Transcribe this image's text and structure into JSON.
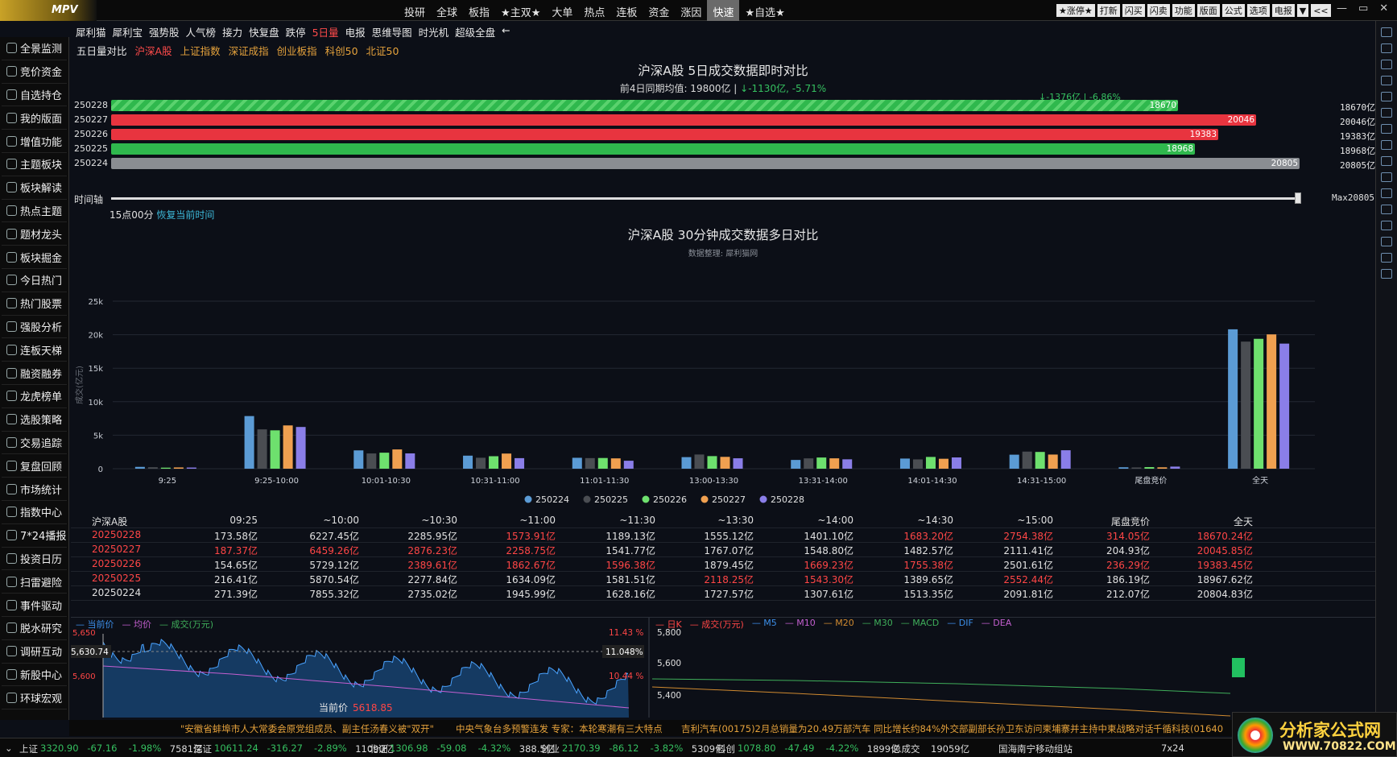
{
  "app": {
    "logo": "MPV"
  },
  "topmenu": [
    "投研",
    "全球",
    "板指",
    "★主双★",
    "大单",
    "热点",
    "连板",
    "资金",
    "涨因",
    "快速",
    "★自选★"
  ],
  "topmenu_active": "快速",
  "topright": [
    "★涨停★",
    "打新",
    "闪买",
    "闪卖",
    "功能",
    "版面",
    "公式",
    "选项",
    "电报",
    "▼",
    "<<"
  ],
  "winctl": [
    "—",
    "▭",
    "✕"
  ],
  "sidebar": [
    {
      "label": "全景监测",
      "icon": "globe-icon"
    },
    {
      "label": "竞价资金",
      "icon": "coin-icon"
    },
    {
      "label": "自选持仓",
      "icon": "home-icon"
    },
    {
      "label": "我的版面",
      "icon": "layout-icon"
    },
    {
      "label": "增值功能",
      "icon": "plus-icon"
    },
    {
      "label": "主题板块",
      "icon": "bar-icon"
    },
    {
      "label": "板块解读",
      "icon": "refresh-icon"
    },
    {
      "label": "热点主题",
      "icon": "gear-icon"
    },
    {
      "label": "题材龙头",
      "icon": "grid-icon"
    },
    {
      "label": "板块掘金",
      "icon": "shovel-icon"
    },
    {
      "label": "今日热门",
      "icon": "fire-icon"
    },
    {
      "label": "热门股票",
      "icon": "stock-icon"
    },
    {
      "label": "强股分析",
      "icon": "chart-icon"
    },
    {
      "label": "连板天梯",
      "icon": "ladder-icon"
    },
    {
      "label": "融资融券",
      "icon": "heart-icon"
    },
    {
      "label": "龙虎榜单",
      "icon": "dragon-icon"
    },
    {
      "label": "选股策略",
      "icon": "filter-icon"
    },
    {
      "label": "交易追踪",
      "icon": "track-icon"
    },
    {
      "label": "复盘回顾",
      "icon": "replay-icon"
    },
    {
      "label": "市场统计",
      "icon": "stats-icon"
    },
    {
      "label": "指数中心",
      "icon": "index-icon"
    },
    {
      "label": "7*24播报",
      "icon": "broadcast-icon"
    },
    {
      "label": "投资日历",
      "icon": "calendar-icon"
    },
    {
      "label": "扫雷避险",
      "icon": "shield-icon"
    },
    {
      "label": "事件驱动",
      "icon": "event-icon"
    },
    {
      "label": "脱水研究",
      "icon": "research-icon"
    },
    {
      "label": "调研互动",
      "icon": "chat-icon"
    },
    {
      "label": "新股中心",
      "icon": "new-icon"
    },
    {
      "label": "环球宏观",
      "icon": "world-icon"
    }
  ],
  "tabs1": [
    "犀利猫",
    "犀利宝",
    "强势股",
    "人气榜",
    "接力",
    "快复盘",
    "跌停",
    "5日量",
    "电报",
    "思维导图",
    "时光机",
    "超级全盘",
    "←"
  ],
  "tabs1_active": "5日量",
  "tabs2": [
    "五日量对比",
    "沪深A股",
    "上证指数",
    "深证成指",
    "创业板指",
    "科创50",
    "北证50"
  ],
  "tabs2_active": "沪深A股",
  "section1": {
    "title": "沪深A股 5日成交数据即时对比",
    "subtitle_prefix": "前4日同期均值: 19800亿 | ",
    "subtitle_change": "↓-1130亿, -5.71%",
    "top_note": "↓-1376亿 | -6.86%",
    "max": 20805,
    "bars": [
      {
        "date": "250228",
        "value": 18670,
        "right": "18670亿",
        "color": "#2fb84d",
        "striped": true
      },
      {
        "date": "250227",
        "value": 20046,
        "right": "20046亿",
        "color": "#e8343f",
        "striped": false
      },
      {
        "date": "250226",
        "value": 19383,
        "right": "19383亿",
        "color": "#e8343f",
        "striped": false
      },
      {
        "date": "250225",
        "value": 18968,
        "right": "18968亿",
        "color": "#2fb84d",
        "striped": false
      },
      {
        "date": "250224",
        "value": 20805,
        "right": "20805亿",
        "color": "#8a8d92",
        "striped": false
      }
    ],
    "timeaxis_label": "时间轴",
    "timeaxis_max": "Max20805",
    "time_now": "15点00分",
    "time_restore": "恢复当前时间"
  },
  "section2": {
    "title": "沪深A股 30分钟成交数据多日对比",
    "source": "数据整理: 犀利猫网"
  },
  "chart_data": {
    "type": "bar",
    "ylabel": "成交(亿元)",
    "ylim": [
      0,
      25000
    ],
    "yticks": [
      "0",
      "5k",
      "10k",
      "15k",
      "20k",
      "25k"
    ],
    "categories": [
      "9:25",
      "9:25-10:00",
      "10:01-10:30",
      "10:31-11:00",
      "11:01-11:30",
      "13:00-13:30",
      "13:31-14:00",
      "14:01-14:30",
      "14:31-15:00",
      "尾盘竞价",
      "全天"
    ],
    "series": [
      {
        "name": "250224",
        "color": "#5b9bd5",
        "values": [
          271.39,
          7855.32,
          2735.02,
          1945.99,
          1628.16,
          1727.57,
          1307.61,
          1513.35,
          2091.81,
          212.07,
          20804.83
        ]
      },
      {
        "name": "250225",
        "color": "#4a4d52",
        "values": [
          216.41,
          5870.54,
          2277.84,
          1634.09,
          1581.51,
          2118.25,
          1543.3,
          1389.65,
          2552.44,
          186.19,
          18967.62
        ]
      },
      {
        "name": "250226",
        "color": "#6ee06e",
        "values": [
          154.65,
          5729.12,
          2389.61,
          1862.67,
          1596.38,
          1879.45,
          1669.23,
          1755.38,
          2501.61,
          236.29,
          19383.45
        ]
      },
      {
        "name": "250227",
        "color": "#f0a050",
        "values": [
          187.37,
          6459.26,
          2876.23,
          2258.75,
          1541.77,
          1767.07,
          1548.8,
          1482.57,
          2111.41,
          204.93,
          20045.85
        ]
      },
      {
        "name": "250228",
        "color": "#8a7ee8",
        "values": [
          173.58,
          6227.45,
          2285.95,
          1573.91,
          1189.13,
          1555.12,
          1401.1,
          1683.2,
          2754.38,
          314.05,
          18670.24
        ]
      }
    ]
  },
  "table": {
    "headers": [
      "沪深A股",
      "09:25",
      "~10:00",
      "~10:30",
      "~11:00",
      "~11:30",
      "~13:30",
      "~14:00",
      "~14:30",
      "~15:00",
      "尾盘竞价",
      "全天"
    ],
    "rows": [
      {
        "date": "20250228",
        "color": "red",
        "cells": [
          "173.58亿",
          "6227.45亿",
          "2285.95亿",
          "1573.91亿",
          "1189.13亿",
          "1555.12亿",
          "1401.10亿",
          "1683.20亿",
          "2754.38亿",
          "314.05亿",
          "18670.24亿"
        ]
      },
      {
        "date": "20250227",
        "color": "red",
        "cells": [
          "187.37亿",
          "6459.26亿",
          "2876.23亿",
          "2258.75亿",
          "1541.77亿",
          "1767.07亿",
          "1548.80亿",
          "1482.57亿",
          "2111.41亿",
          "204.93亿",
          "20045.85亿"
        ]
      },
      {
        "date": "20250226",
        "color": "red",
        "cells": [
          "154.65亿",
          "5729.12亿",
          "2389.61亿",
          "1862.67亿",
          "1596.38亿",
          "1879.45亿",
          "1669.23亿",
          "1755.38亿",
          "2501.61亿",
          "236.29亿",
          "19383.45亿"
        ]
      },
      {
        "date": "20250225",
        "color": "red",
        "cells": [
          "216.41亿",
          "5870.54亿",
          "2277.84亿",
          "1634.09亿",
          "1581.51亿",
          "2118.25亿",
          "1543.30亿",
          "1389.65亿",
          "2552.44亿",
          "186.19亿",
          "18967.62亿"
        ]
      },
      {
        "date": "20250224",
        "color": "white",
        "cells": [
          "271.39亿",
          "7855.32亿",
          "2735.02亿",
          "1945.99亿",
          "1628.16亿",
          "1727.57亿",
          "1307.61亿",
          "1513.35亿",
          "2091.81亿",
          "212.07亿",
          "20804.83亿"
        ]
      }
    ],
    "cell_colors": [
      [
        "white",
        "white",
        "white",
        "red",
        "white",
        "white",
        "white",
        "red",
        "red",
        "red",
        "red"
      ],
      [
        "red",
        "red",
        "red",
        "red",
        "white",
        "white",
        "white",
        "white",
        "white",
        "white",
        "red"
      ],
      [
        "white",
        "white",
        "red",
        "red",
        "red",
        "white",
        "red",
        "red",
        "white",
        "red",
        "red"
      ],
      [
        "white",
        "white",
        "white",
        "white",
        "white",
        "red",
        "red",
        "white",
        "red",
        "white",
        "white"
      ],
      [
        "white",
        "white",
        "white",
        "white",
        "white",
        "white",
        "white",
        "white",
        "white",
        "white",
        "white"
      ]
    ]
  },
  "intraday": {
    "legend": [
      "当前价",
      "均价",
      "成交(万元)"
    ],
    "price_high": "5,650",
    "price_low": "5,600",
    "crosshair": "5,630.74",
    "pct_high": "11.43 %",
    "pct_mid": "11.048%",
    "pct_low": "10.44 %",
    "current_label": "当前价",
    "current_value": "5618.85"
  },
  "kline": {
    "legend": [
      "日K",
      "成交(万元)",
      "M5",
      "M10",
      "M20",
      "M30",
      "MACD",
      "DIF",
      "DEA"
    ],
    "p1": "5,800",
    "p2": "5,600",
    "p3": "5,400"
  },
  "news": [
    "\"安徽省蚌埠市人大常委会原党组成员、副主任汤春义被\"双开\"",
    "中央气象台多预警连发 专家：本轮寒潮有三大特点",
    "吉利汽车(00175)2月总销量为20.49万部汽车 同比增长约84%",
    "外交部副部长孙卫东访问柬埔寨并主持中柬战略对话",
    "千循科技(01640"
  ],
  "status": {
    "sh": {
      "name": "上证",
      "price": "3320.90",
      "chg": "-67.16",
      "pct": "-1.98%",
      "vol": "7581亿"
    },
    "sz": {
      "name": "深证",
      "price": "10611.24",
      "chg": "-316.27",
      "pct": "-2.89%",
      "vol": "11090亿"
    },
    "bz": {
      "name": "北证",
      "price": "1306.98",
      "chg": "-59.08",
      "pct": "-4.32%",
      "vol": "388.5亿"
    },
    "cy": {
      "name": "创业",
      "price": "2170.39",
      "chg": "-86.12",
      "pct": "-3.82%",
      "vol": "5309亿"
    },
    "kc": {
      "name": "科创",
      "price": "1078.80",
      "chg": "-47.49",
      "pct": "-4.22%",
      "vol": "1899亿"
    },
    "total_label": "总成交",
    "total": "19059亿",
    "server": "国海南宁移动组站",
    "mode": "7x24"
  },
  "brand": {
    "title": "分析家公式网",
    "url": "WWW.70822.COM"
  }
}
